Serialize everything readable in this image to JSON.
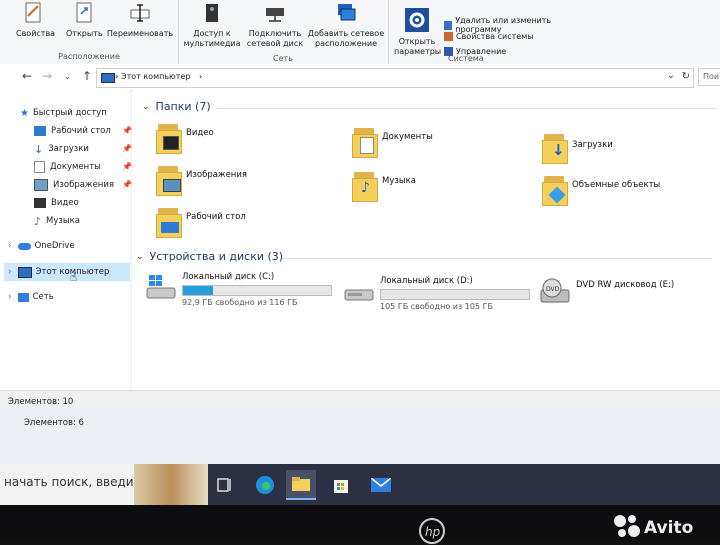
{
  "ribbon": {
    "layout_group": {
      "label": "Расположение",
      "buttons": [
        "Свойства",
        "Открыть",
        "Переименовать"
      ]
    },
    "network_group": {
      "label": "Сеть",
      "buttons": [
        {
          "line1": "Доступ к",
          "line2": "мультимедиа"
        },
        {
          "line1": "Подключить",
          "line2": "сетевой диск"
        },
        {
          "line1": "Добавить сетевое",
          "line2": "расположение"
        }
      ]
    },
    "system_group": {
      "label": "Система",
      "open_params": {
        "line1": "Открыть",
        "line2": "параметры"
      },
      "items": [
        "Удалить или изменить программу",
        "Свойства системы",
        "Управление"
      ]
    }
  },
  "address": {
    "path": "Этот компьютер",
    "search_placeholder": "Пои"
  },
  "nav": {
    "quick_access": "Быстрый доступ",
    "items": [
      "Рабочий стол",
      "Загрузки",
      "Документы",
      "Изображения",
      "Видео",
      "Музыка"
    ],
    "onedrive": "OneDrive",
    "this_pc": "Этот компьютер",
    "network": "Сеть"
  },
  "folders": {
    "header": "Папки (7)",
    "items": [
      "Видео",
      "Документы",
      "Загрузки",
      "Изображения",
      "Музыка",
      "Объемные объекты",
      "Рабочий стол"
    ]
  },
  "devices": {
    "header": "Устройства и диски (3)",
    "drives": [
      {
        "name": "Локальный диск (C:)",
        "free": "92,9 ГБ свободно из 116 ГБ",
        "used_fraction": 0.2
      },
      {
        "name": "Локальный диск (D:)",
        "free": "105 ГБ свободно из 105 ГБ",
        "used_fraction": 0.0
      },
      {
        "name": "DVD RW дисковод (E:)"
      }
    ]
  },
  "status": {
    "elements_front": "Элементов: 10",
    "elements_back": "Элементов: 6"
  },
  "taskbar": {
    "search_text": "начать поиск, введите"
  },
  "colors": {
    "accent": "#26a0da",
    "folder": "#f5cf5c",
    "taskbar": "#2b3042"
  }
}
